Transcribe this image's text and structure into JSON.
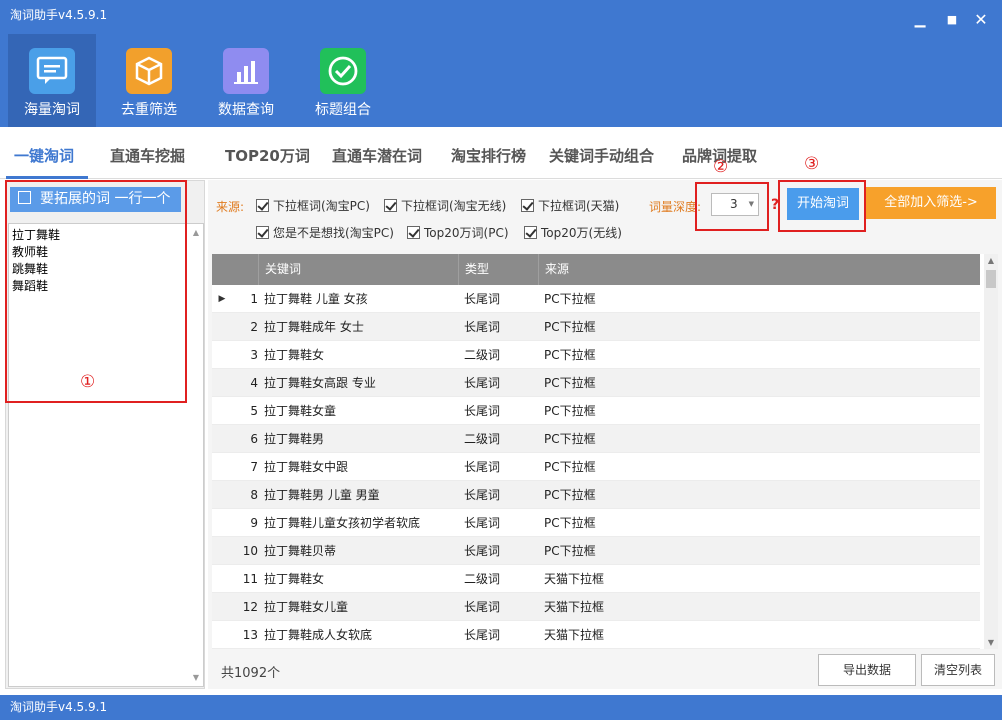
{
  "window": {
    "title": "淘词助手v4.5.9.1"
  },
  "nav": [
    {
      "label": "海量淘词",
      "icon": "chat-icon",
      "color": "#4a9fe8"
    },
    {
      "label": "去重筛选",
      "icon": "cube-icon",
      "color": "#f2a02c"
    },
    {
      "label": "数据查询",
      "icon": "bar-chart-icon",
      "color": "#8f8cf0"
    },
    {
      "label": "标题组合",
      "icon": "check-circle-icon",
      "color": "#21c05a"
    }
  ],
  "tabs": [
    "一键淘词",
    "直通车挖掘",
    "TOP20万词",
    "直通车潜在词",
    "淘宝排行榜",
    "关键词手动组合",
    "品牌词提取"
  ],
  "left": {
    "button_label": "要拓展的词 一行一个",
    "keywords": "拉丁舞鞋\n教师鞋\n跳舞鞋\n舞蹈鞋"
  },
  "options": {
    "source_label": "来源:",
    "checkboxes": [
      "下拉框词(淘宝PC)",
      "下拉框词(淘宝无线)",
      "下拉框词(天猫)",
      "您是不是想找(淘宝PC)",
      "Top20万词(PC)",
      "Top20万(无线)"
    ],
    "depth_label": "词量深度:",
    "depth_value": "3",
    "help": "?",
    "start_label": "开始淘词",
    "add_all_label": "全部加入筛选->"
  },
  "annotations": [
    "①",
    "②",
    "③"
  ],
  "table": {
    "columns": [
      "关键词",
      "类型",
      "来源"
    ],
    "rows": [
      [
        "1",
        "拉丁舞鞋 儿童 女孩",
        "长尾词",
        "PC下拉框"
      ],
      [
        "2",
        "拉丁舞鞋成年 女士",
        "长尾词",
        "PC下拉框"
      ],
      [
        "3",
        "拉丁舞鞋女",
        "二级词",
        "PC下拉框"
      ],
      [
        "4",
        "拉丁舞鞋女高跟 专业",
        "长尾词",
        "PC下拉框"
      ],
      [
        "5",
        "拉丁舞鞋女童",
        "长尾词",
        "PC下拉框"
      ],
      [
        "6",
        "拉丁舞鞋男",
        "二级词",
        "PC下拉框"
      ],
      [
        "7",
        "拉丁舞鞋女中跟",
        "长尾词",
        "PC下拉框"
      ],
      [
        "8",
        "拉丁舞鞋男 儿童 男童",
        "长尾词",
        "PC下拉框"
      ],
      [
        "9",
        "拉丁舞鞋儿童女孩初学者软底",
        "长尾词",
        "PC下拉框"
      ],
      [
        "10",
        "拉丁舞鞋贝蒂",
        "长尾词",
        "PC下拉框"
      ],
      [
        "11",
        "拉丁舞鞋女",
        "二级词",
        "天猫下拉框"
      ],
      [
        "12",
        "拉丁舞鞋女儿童",
        "长尾词",
        "天猫下拉框"
      ],
      [
        "13",
        "拉丁舞鞋成人女软底",
        "长尾词",
        "天猫下拉框"
      ]
    ]
  },
  "footer": {
    "count": "共1092个",
    "export_label": "导出数据",
    "clear_label": "清空列表"
  },
  "status": {
    "text": "淘词助手v4.5.9.1"
  }
}
